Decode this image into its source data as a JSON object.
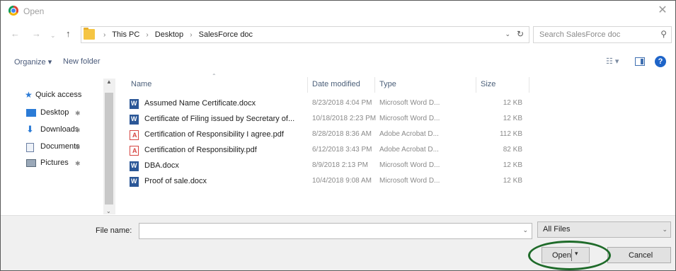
{
  "window": {
    "title": "Open",
    "close_glyph": "✕"
  },
  "nav": {
    "back_glyph": "←",
    "forward_glyph": "→",
    "recent_glyph": "⌄",
    "up_glyph": "↑",
    "breadcrumb": [
      "This PC",
      "Desktop",
      "SalesForce doc"
    ],
    "separator": "›",
    "dropdown_glyph": "⌄",
    "refresh_glyph": "↻",
    "search_placeholder": "Search SalesForce doc",
    "search_glyph": "⚲"
  },
  "toolbar": {
    "organize_label": "Organize ▾",
    "new_folder_label": "New folder",
    "view_glyph": "☷ ▾",
    "help_glyph": "?"
  },
  "navpane": {
    "quick_access": "Quick access",
    "items": [
      {
        "label": "Desktop",
        "icon": "desktop-icon"
      },
      {
        "label": "Downloads",
        "icon": "downloads-icon"
      },
      {
        "label": "Documents",
        "icon": "documents-icon"
      },
      {
        "label": "Pictures",
        "icon": "pictures-icon"
      }
    ],
    "pin_glyph": "✱",
    "scroll_up_glyph": "▲",
    "scroll_down_glyph": "⌄"
  },
  "filelist": {
    "columns": {
      "name": "Name",
      "date": "Date modified",
      "type": "Type",
      "size": "Size"
    },
    "sort_glyph": "⌃",
    "rows": [
      {
        "name": "Assumed Name Certificate.docx",
        "date": "8/23/2018 4:04 PM",
        "type": "Microsoft Word D...",
        "size": "12 KB",
        "kind": "word"
      },
      {
        "name": "Certificate of Filing issued by Secretary of...",
        "date": "10/18/2018 2:23 PM",
        "type": "Microsoft Word D...",
        "size": "12 KB",
        "kind": "word"
      },
      {
        "name": "Certification of Responsibility I agree.pdf",
        "date": "8/28/2018 8:36 AM",
        "type": "Adobe Acrobat D...",
        "size": "112 KB",
        "kind": "pdf"
      },
      {
        "name": "Certification of Responsibility.pdf",
        "date": "6/12/2018 3:43 PM",
        "type": "Adobe Acrobat D...",
        "size": "82 KB",
        "kind": "pdf"
      },
      {
        "name": "DBA.docx",
        "date": "8/9/2018 2:13 PM",
        "type": "Microsoft Word D...",
        "size": "12 KB",
        "kind": "word"
      },
      {
        "name": "Proof of sale.docx",
        "date": "10/4/2018 9:08 AM",
        "type": "Microsoft Word D...",
        "size": "12 KB",
        "kind": "word"
      }
    ]
  },
  "footer": {
    "file_name_label": "File name:",
    "file_name_value": "",
    "file_type_value": "All Files",
    "open_label": "Open",
    "open_caret": "▾",
    "cancel_label": "Cancel",
    "dropdown_glyph": "⌄",
    "highlight_color": "#1f6b2a"
  }
}
